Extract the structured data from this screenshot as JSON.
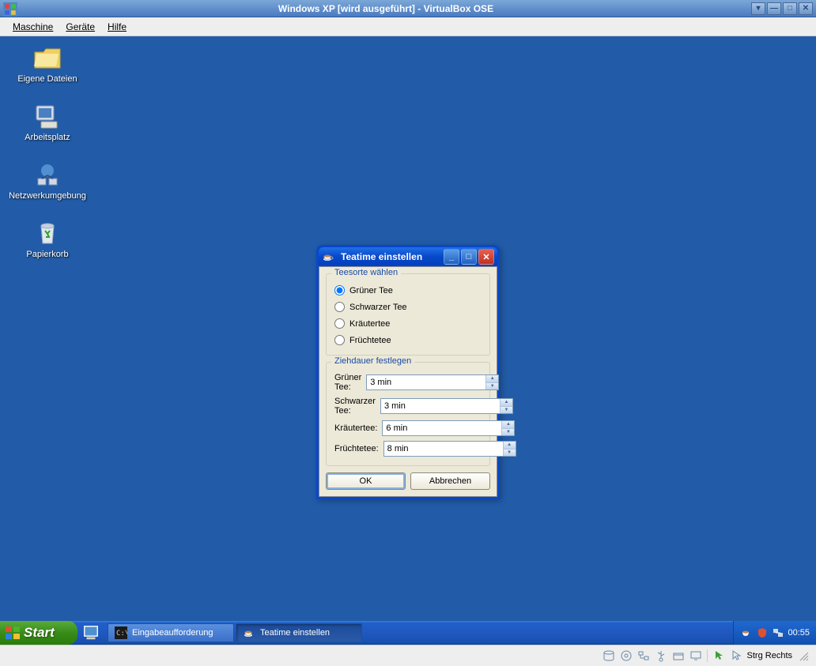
{
  "vbox": {
    "title": "Windows XP [wird ausgeführt] - VirtualBox OSE",
    "menu": {
      "machine": "Maschine",
      "devices": "Geräte",
      "help": "Hilfe"
    },
    "statusbar": {
      "hostkey": "Strg Rechts"
    }
  },
  "desktop": {
    "icons": [
      {
        "name": "my-documents",
        "label": "Eigene Dateien"
      },
      {
        "name": "my-computer",
        "label": "Arbeitsplatz"
      },
      {
        "name": "network-places",
        "label": "Netzwerkumgebung"
      },
      {
        "name": "recycle-bin",
        "label": "Papierkorb"
      }
    ]
  },
  "dialog": {
    "title": "Teatime einstellen",
    "group1": {
      "legend": "Teesorte wählen",
      "options": [
        {
          "label": "Grüner Tee",
          "checked": true
        },
        {
          "label": "Schwarzer Tee",
          "checked": false
        },
        {
          "label": "Kräutertee",
          "checked": false
        },
        {
          "label": "Früchtetee",
          "checked": false
        }
      ]
    },
    "group2": {
      "legend": "Ziehdauer festlegen",
      "rows": [
        {
          "label": "Grüner Tee:",
          "value": "3 min"
        },
        {
          "label": "Schwarzer Tee:",
          "value": "3 min"
        },
        {
          "label": "Kräutertee:",
          "value": "6 min"
        },
        {
          "label": "Früchtetee:",
          "value": "8 min"
        }
      ]
    },
    "buttons": {
      "ok": "OK",
      "cancel": "Abbrechen"
    }
  },
  "taskbar": {
    "start": "Start",
    "tasks": [
      {
        "label": "Eingabeaufforderung",
        "active": false
      },
      {
        "label": "Teatime einstellen",
        "active": true
      }
    ],
    "clock": "00:55"
  }
}
